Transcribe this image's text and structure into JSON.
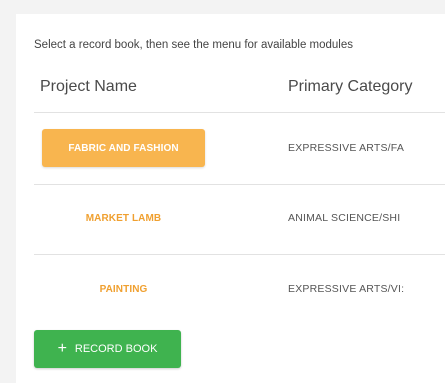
{
  "instructions": "Select a record book, then see the menu for available modules",
  "table": {
    "headers": {
      "project_name": "Project Name",
      "primary_category": "Primary Category"
    },
    "rows": [
      {
        "project": "FABRIC AND FASHION",
        "category": "EXPRESSIVE ARTS/FA"
      },
      {
        "project": "MARKET LAMB",
        "category": "ANIMAL SCIENCE/SHI"
      },
      {
        "project": "PAINTING",
        "category": "EXPRESSIVE ARTS/VI:"
      }
    ]
  },
  "add_button": {
    "icon": "+",
    "label": "RECORD BOOK"
  },
  "colors": {
    "accent_orange": "#f8b54f",
    "text_orange": "#f0a030",
    "add_green": "#3fb34f"
  }
}
